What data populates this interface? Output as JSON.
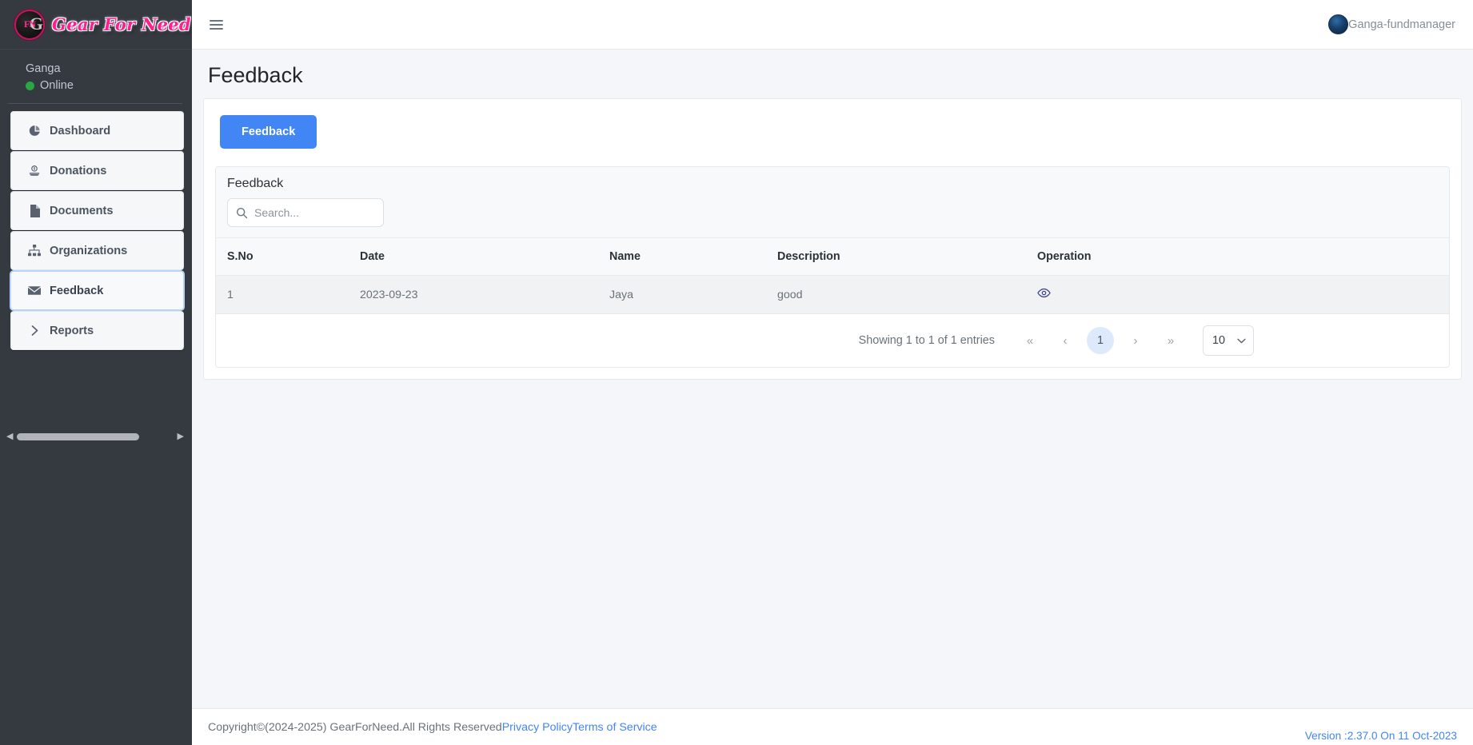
{
  "sidebar": {
    "brand_name": "Gear For Need",
    "logo_text": "FN",
    "logo_g": "G",
    "user_name": "Ganga",
    "user_status": "Online",
    "items": [
      {
        "label": "Dashboard",
        "icon": "pie-chart-icon",
        "active": false
      },
      {
        "label": "Donations",
        "icon": "donation-icon",
        "active": false
      },
      {
        "label": "Documents",
        "icon": "document-icon",
        "active": false
      },
      {
        "label": "Organizations",
        "icon": "sitemap-icon",
        "active": false
      },
      {
        "label": "Feedback",
        "icon": "envelope-icon",
        "active": true
      },
      {
        "label": "Reports",
        "icon": "chevron-right-icon",
        "active": false
      }
    ]
  },
  "topbar": {
    "menu_icon": "hamburger-icon",
    "user_label": "Ganga-fundmanager",
    "avatar_icon": "user-avatar"
  },
  "page": {
    "title": "Feedback",
    "action_button": "Feedback"
  },
  "card": {
    "title": "Feedback",
    "search_placeholder": "Search...",
    "search_value": "",
    "search_icon": "search-icon",
    "columns": [
      "S.No",
      "Date",
      "Name",
      "Description",
      "Operation"
    ],
    "rows": [
      {
        "sno": "1",
        "date": "2023-09-23",
        "name": "Jaya",
        "description": "good",
        "operation_icon": "eye-icon"
      }
    ]
  },
  "pagination": {
    "showing_text": "Showing 1 to 1 of 1 entries",
    "first_label": "«",
    "prev_label": "‹",
    "current_page": "1",
    "next_label": "›",
    "last_label": "»",
    "page_size": "10"
  },
  "footer": {
    "copyright": "Copyright©(2024-2025) GearForNeed.All Rights Reserved ",
    "privacy_link": "Privacy Policy",
    "terms_link": "Terms of Service",
    "version": "Version :2.37.0 On 11 Oct-2023"
  },
  "colors": {
    "accent_blue": "#4285f4",
    "sidebar_bg": "#343a40",
    "active_border": "#b6d4fe",
    "brand_pink": "#ff1f8f",
    "online_green": "#28a745",
    "eye_indigo": "#3b3f8f"
  }
}
